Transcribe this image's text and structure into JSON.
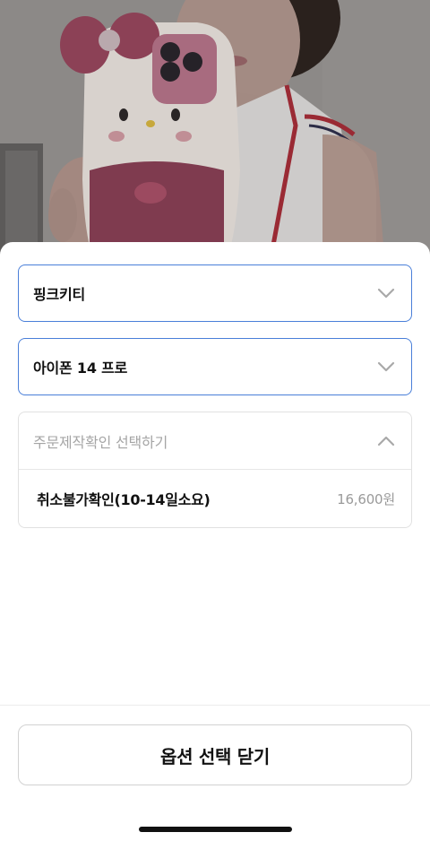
{
  "background": {
    "image": "product-photo-hello-kitty-fluffy-phone-case"
  },
  "options": {
    "design_select": {
      "value": "핑크키티",
      "icon": "chevron-down-icon"
    },
    "model_select": {
      "value": "아이폰 14 프로",
      "icon": "chevron-down-icon"
    },
    "confirm_panel": {
      "placeholder": "주문제작확인 선택하기",
      "icon": "chevron-up-icon",
      "items": [
        {
          "name": "취소불가확인(10-14일소요)",
          "price": "16,600원"
        }
      ]
    }
  },
  "footer": {
    "close_label": "옵션 선택 닫기"
  },
  "colors": {
    "accent_border": "#4a7fd9",
    "sheet_bg": "#ffffff",
    "muted_text": "#a5a5a5"
  }
}
